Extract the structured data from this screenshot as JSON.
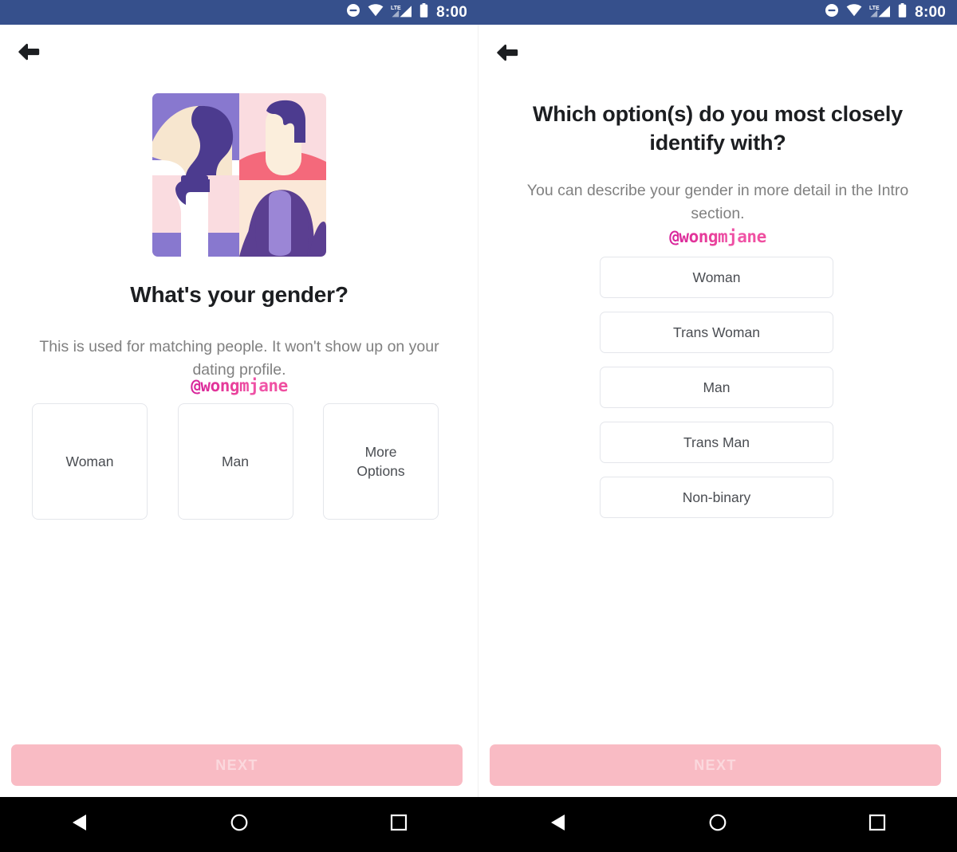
{
  "status_bar": {
    "background_color": "#36508c",
    "time": "8:00",
    "icons": [
      "do-not-disturb-icon",
      "wifi-icon",
      "lte-signal-icon",
      "battery-icon"
    ],
    "lte_label": "LTE"
  },
  "watermark": {
    "handle": "@wongmjane",
    "color": "#e83f9a"
  },
  "left_screen": {
    "back_label": "←",
    "illustration": {
      "name": "gender-collage-illustration",
      "tiles": [
        {
          "name": "woman-profile-tile",
          "bg": "#8878cf",
          "skin": "#f7e6cf",
          "hair": "#4c3b8f"
        },
        {
          "name": "man-portrait-tile",
          "bg": "#fadce0",
          "skin": "#fbeedc",
          "hair": "#4c3b8f",
          "shirt": "#f4697b"
        },
        {
          "name": "person-back-tile",
          "bg": "#fadce0",
          "skin": "#ffffff",
          "hair": "#4c3b8f",
          "band": "#8878cf"
        },
        {
          "name": "long-hair-person-tile",
          "bg": "#fbe8d8",
          "skin": "#9b86d6",
          "hair": "#5b3f91"
        }
      ]
    },
    "title": "What's your gender?",
    "subtitle": "This is used for matching people. It won't show up on your dating profile.",
    "options": [
      {
        "label": "Woman"
      },
      {
        "label": "Man"
      },
      {
        "label": "More\nOptions"
      }
    ],
    "next_label": "NEXT",
    "next_enabled": false
  },
  "right_screen": {
    "back_label": "←",
    "title": "Which option(s) do you most closely identify with?",
    "subtitle": "You can describe your gender in more detail in the Intro section.",
    "options": [
      {
        "label": "Woman"
      },
      {
        "label": "Trans Woman"
      },
      {
        "label": "Man"
      },
      {
        "label": "Trans Man"
      },
      {
        "label": "Non-binary"
      }
    ],
    "next_label": "NEXT",
    "next_enabled": false
  },
  "nav_bar": {
    "background_color": "#000000",
    "keys": [
      "back-triangle-icon",
      "home-circle-icon",
      "recents-square-icon"
    ]
  },
  "theme": {
    "accent_pink": "#f9bbc4",
    "border_gray": "#e4e6eb",
    "text_primary": "#1c1e21",
    "text_secondary": "#808080"
  }
}
